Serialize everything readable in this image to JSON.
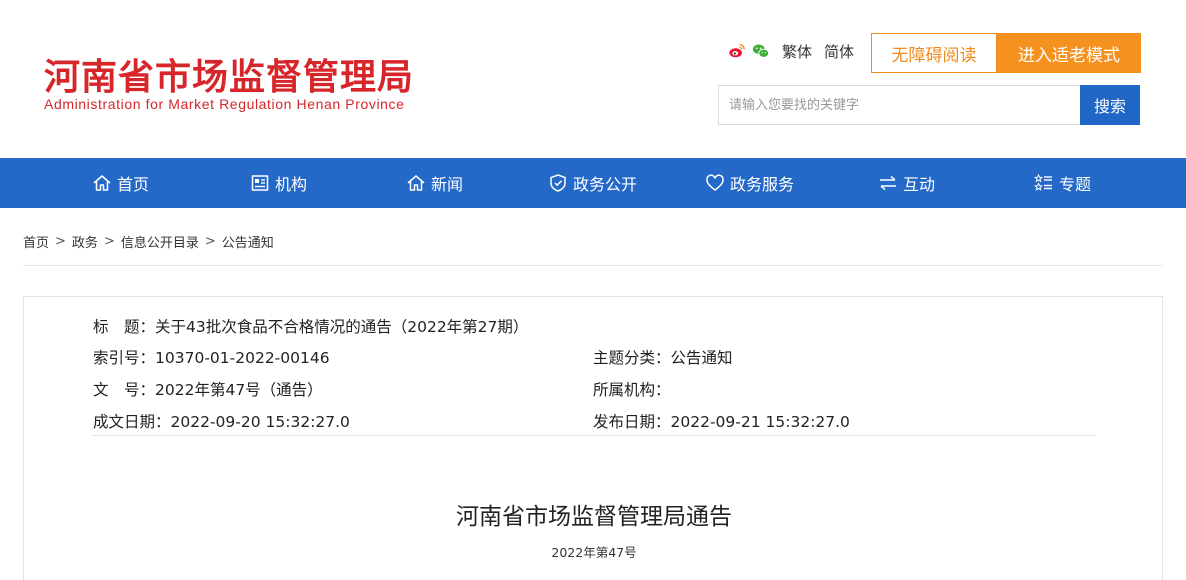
{
  "header": {
    "logo_cn": "河南省市场监督管理局",
    "logo_en": "Administration for Market Regulation Henan Province",
    "weibo_icon": "weibo-icon",
    "wechat_icon": "wechat-icon",
    "traditional": "繁体",
    "simplified": "简体",
    "accessible_reading": "无障碍阅读",
    "elder_mode": "进入适老模式",
    "search_placeholder": "请输入您要找的关键字",
    "search_button": "搜索"
  },
  "nav": {
    "items": [
      {
        "label": "首页",
        "icon": "home-icon"
      },
      {
        "label": "机构",
        "icon": "organization-icon"
      },
      {
        "label": "新闻",
        "icon": "news-icon"
      },
      {
        "label": "政务公开",
        "icon": "shield-icon"
      },
      {
        "label": "政务服务",
        "icon": "heart-icon"
      },
      {
        "label": "互动",
        "icon": "exchange-icon"
      },
      {
        "label": "专题",
        "icon": "topics-icon"
      }
    ]
  },
  "breadcrumb": {
    "items": [
      "首页",
      "政务",
      "信息公开目录",
      "公告通知"
    ],
    "separator": ">"
  },
  "meta": {
    "title_label": "标　题：",
    "title_value": "关于43批次食品不合格情况的通告（2022年第27期）",
    "index_label": "索引号：",
    "index_value": "10370-01-2022-00146",
    "category_label": "主题分类：",
    "category_value": "公告通知",
    "docno_label": "文　号：",
    "docno_value": "2022年第47号（通告）",
    "org_label": "所属机构：",
    "org_value": "",
    "created_label": "成文日期：",
    "created_value": "2022-09-20 15:32:27.0",
    "published_label": "发布日期：",
    "published_value": "2022-09-21 15:32:27.0"
  },
  "document": {
    "heading": "河南省市场监督管理局通告",
    "number": "2022年第47号"
  },
  "colors": {
    "brand_red": "#d7262a",
    "nav_blue": "#2468c8",
    "accent_orange": "#f5921f"
  }
}
